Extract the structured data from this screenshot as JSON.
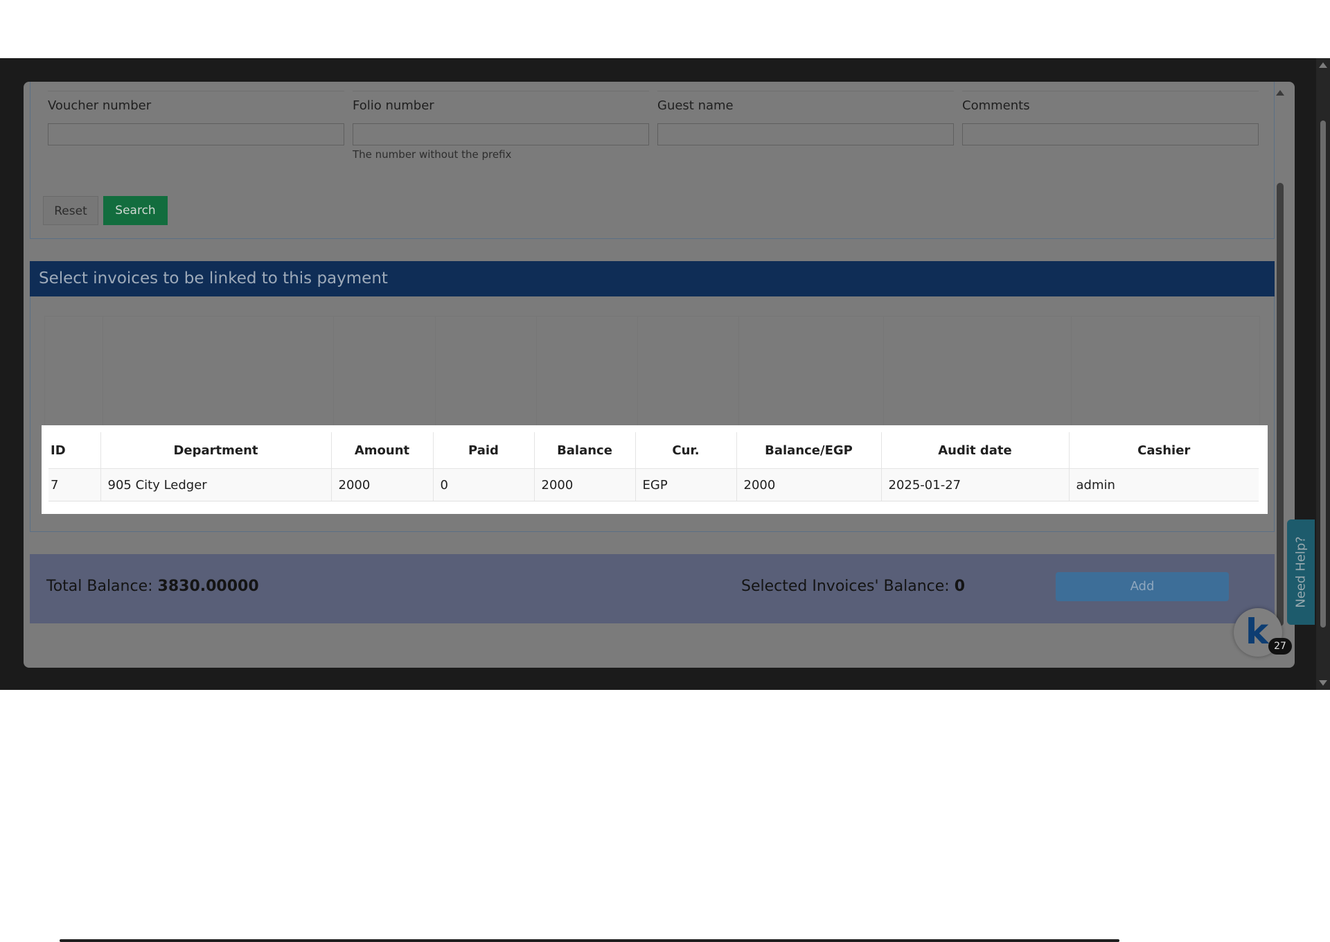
{
  "search": {
    "fields": [
      {
        "label": "Voucher number",
        "value": "",
        "hint": ""
      },
      {
        "label": "Folio number",
        "value": "",
        "hint": "The number without the prefix"
      },
      {
        "label": "Guest name",
        "value": "",
        "hint": ""
      },
      {
        "label": "Comments",
        "value": "",
        "hint": ""
      }
    ],
    "reset_label": "Reset",
    "search_label": "Search"
  },
  "invoices": {
    "title": "Select invoices to be linked to this payment",
    "columns": [
      "ID",
      "Department",
      "Amount",
      "Paid",
      "Balance",
      "Cur.",
      "Balance/EGP",
      "Audit date",
      "Cashier"
    ],
    "rows": [
      [
        "7",
        "905 City Ledger",
        "2000",
        "0",
        "2000",
        "EGP",
        "2000",
        "2025-01-27",
        "admin"
      ]
    ]
  },
  "totals": {
    "total_balance_label": "Total Balance:",
    "total_balance_value": "3830.00000",
    "selected_balance_label": "Selected Invoices' Balance:",
    "selected_balance_value": "0",
    "add_label": "Add"
  },
  "help": {
    "need_help_label": "Need Help?",
    "chat_badge_count": "27",
    "chat_logo_letter": "k"
  },
  "colors": {
    "header_bar": "#0f2d56",
    "search_button": "#126d3e",
    "add_button": "#3d6e98",
    "totals_bar": "#595f78"
  }
}
